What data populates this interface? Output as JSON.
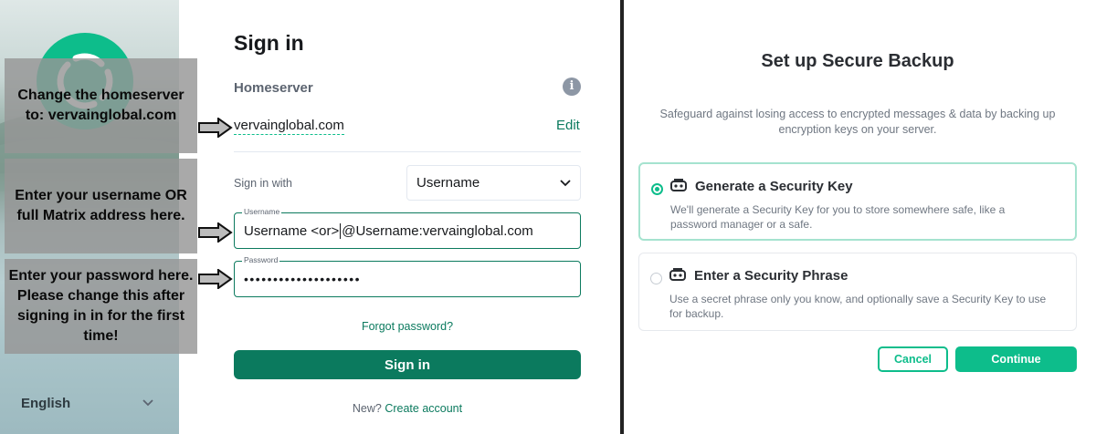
{
  "language": {
    "label": "English",
    "icon": "chevron-down-icon"
  },
  "callouts": [
    "Change the homeserver to: vervainglobal.com",
    "Enter your username OR full Matrix address here.",
    "Enter your password here. Please change this after signing in in for the first time!"
  ],
  "signin": {
    "title": "Sign in",
    "homeserver_label": "Homeserver",
    "info_icon": "info-icon",
    "homeserver_value": "vervainglobal.com",
    "edit_label": "Edit",
    "sign_in_with_label": "Sign in with",
    "sign_in_with_selected": "Username",
    "username_label": "Username",
    "username_value_a": "Username <or>",
    "username_value_b": "@Username:vervainglobal.com",
    "password_label": "Password",
    "password_value": "••••••••••••••••••••",
    "forgot_password": "Forgot password?",
    "submit_label": "Sign in",
    "new_prefix": "New?",
    "create_account": "Create account"
  },
  "backup": {
    "title": "Set up Secure Backup",
    "description": "Safeguard against losing access to encrypted messages & data by backing up encryption keys on your server.",
    "options": [
      {
        "title": "Generate a Security Key",
        "description": "We'll generate a Security Key for you to store somewhere safe, like a password manager or a safe.",
        "selected": true,
        "icon": "key-icon"
      },
      {
        "title": "Enter a Security Phrase",
        "description": "Use a secret phrase only you know, and optionally save a Security Key to use for backup.",
        "selected": false,
        "icon": "key-icon"
      }
    ],
    "cancel_label": "Cancel",
    "continue_label": "Continue"
  },
  "colors": {
    "accent": "#0dbd8b",
    "accent_dark": "#0b7a5e"
  }
}
